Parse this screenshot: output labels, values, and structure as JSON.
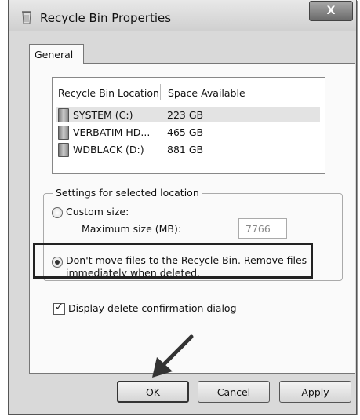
{
  "window": {
    "title": "Recycle Bin Properties",
    "close_label": "X"
  },
  "tabs": [
    {
      "label": "General"
    }
  ],
  "list": {
    "headers": {
      "location": "Recycle Bin Location",
      "space": "Space Available"
    },
    "rows": [
      {
        "name": "SYSTEM (C:)",
        "space": "223 GB",
        "selected": true
      },
      {
        "name": "VERBATIM HD...",
        "space": "465 GB",
        "selected": false
      },
      {
        "name": "WDBLACK (D:)",
        "space": "881 GB",
        "selected": false
      }
    ]
  },
  "settings": {
    "group_label": "Settings for selected location",
    "custom_size_label": "Custom size:",
    "max_size_label": "Maximum size (MB):",
    "max_size_value": "7766",
    "dont_move_line1": "Don't move files to the Recycle Bin. Remove files",
    "dont_move_line2": "immediately when deleted.",
    "selected_option": "dont_move"
  },
  "confirm_dialog": {
    "label": "Display delete confirmation dialog",
    "checked": true
  },
  "buttons": {
    "ok": "OK",
    "cancel": "Cancel",
    "apply": "Apply"
  }
}
